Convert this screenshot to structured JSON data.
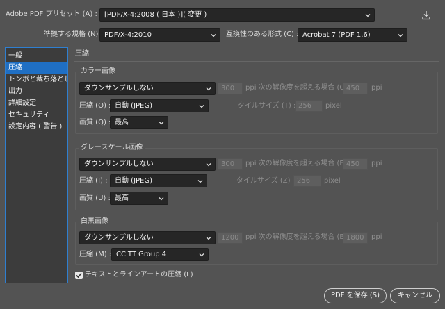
{
  "header": {
    "preset_label": "Adobe PDF プリセット (A) :",
    "preset_value": "[PDF/X-4:2008 ( 日本 )]( 変更 )",
    "standard_label": "準拠する規格 (N) :",
    "standard_value": "PDF/X-4:2010",
    "compat_label": "互換性のある形式 (C) :",
    "compat_value": "Acrobat 7 (PDF 1.6)"
  },
  "sidebar": {
    "items": [
      {
        "label": "一般"
      },
      {
        "label": "圧縮"
      },
      {
        "label": "トンボと裁ち落とし"
      },
      {
        "label": "出力"
      },
      {
        "label": "詳細設定"
      },
      {
        "label": "セキュリティ"
      },
      {
        "label": "設定内容 ( 警告 )"
      }
    ]
  },
  "main": {
    "section_title": "圧縮",
    "color": {
      "title": "カラー画像",
      "downsample": "ダウンサンプルしない",
      "ppi1": "300",
      "ppi_text": "ppi 次の解像度を超える場合 (G)",
      "ppi2": "450",
      "ppi_unit": "ppi",
      "compression_label": "圧縮 (O) :",
      "compression": "自動 (JPEG)",
      "tile_label": "タイルサイズ (T) :",
      "tile_value": "256",
      "tile_unit": "pixel",
      "quality_label": "画質 (Q) :",
      "quality": "最高"
    },
    "gray": {
      "title": "グレースケール画像",
      "downsample": "ダウンサンプルしない",
      "ppi1": "300",
      "ppi_text": "ppi 次の解像度を超える場合 (E)",
      "ppi2": "450",
      "ppi_unit": "ppi",
      "compression_label": "圧縮 (I) :",
      "compression": "自動 (JPEG)",
      "tile_label": "タイルサイズ (Z) :",
      "tile_value": "256",
      "tile_unit": "pixel",
      "quality_label": "画質 (U) :",
      "quality": "最高"
    },
    "mono": {
      "title": "白黒画像",
      "downsample": "ダウンサンプルしない",
      "ppi1": "1200",
      "ppi_text": "ppi 次の解像度を超える場合 (B)",
      "ppi2": "1800",
      "ppi_unit": "ppi",
      "compression_label": "圧縮 (M) :",
      "compression": "CCITT Group 4"
    },
    "compress_text_label": "テキストとラインアートの圧縮 (L)"
  },
  "footer": {
    "save_label": "PDF を保存 (S)",
    "cancel_label": "キャンセル"
  },
  "colors": {
    "background": "#535353",
    "selection": "#1f6fc4",
    "control": "#262626"
  }
}
